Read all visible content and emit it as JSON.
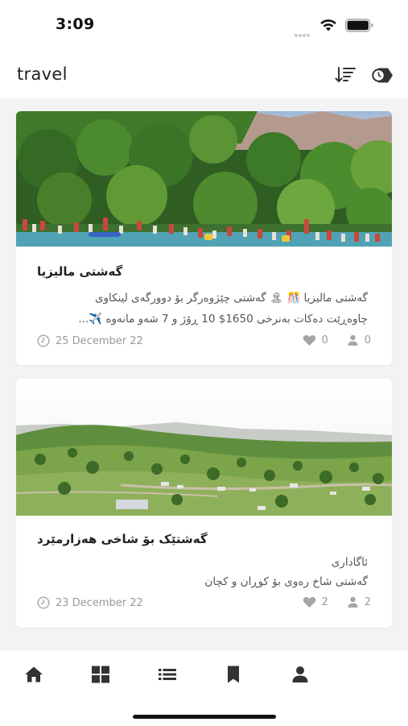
{
  "status_bar": {
    "time": "3:09"
  },
  "app_bar": {
    "title": "travel"
  },
  "cards": [
    {
      "title": "گەشتی مالیزیا",
      "body_lines": [
        "گەشتی مالیزیا  🎊  🏝 گەشتی چێژوەرگر بۆ دوورگەی لینکاوی",
        "چاوەڕێت دەکات بەنرخی 1650$  10 ڕۆژ و 7 شەو مانەوە ✈️..."
      ],
      "date": "25 December 22",
      "likes": "0",
      "members": "0"
    },
    {
      "title": "گەشتێک بۆ شاخی هەزارمێرد",
      "body_lines": [
        "ئاگاداری",
        "گەشتی شاخ رەوی بۆ کوڕان و کچان"
      ],
      "date": "23 December 22",
      "likes": "2",
      "members": "2"
    }
  ],
  "nav": {
    "items": [
      {
        "icon": "home-icon"
      },
      {
        "icon": "grid-icon"
      },
      {
        "icon": "list-icon"
      },
      {
        "icon": "bookmark-icon"
      },
      {
        "icon": "person-icon"
      }
    ],
    "active_color": "#333333"
  },
  "colors": {
    "background": "#f3f3f3",
    "card": "#ffffff",
    "meta": "#9a9a9a"
  }
}
